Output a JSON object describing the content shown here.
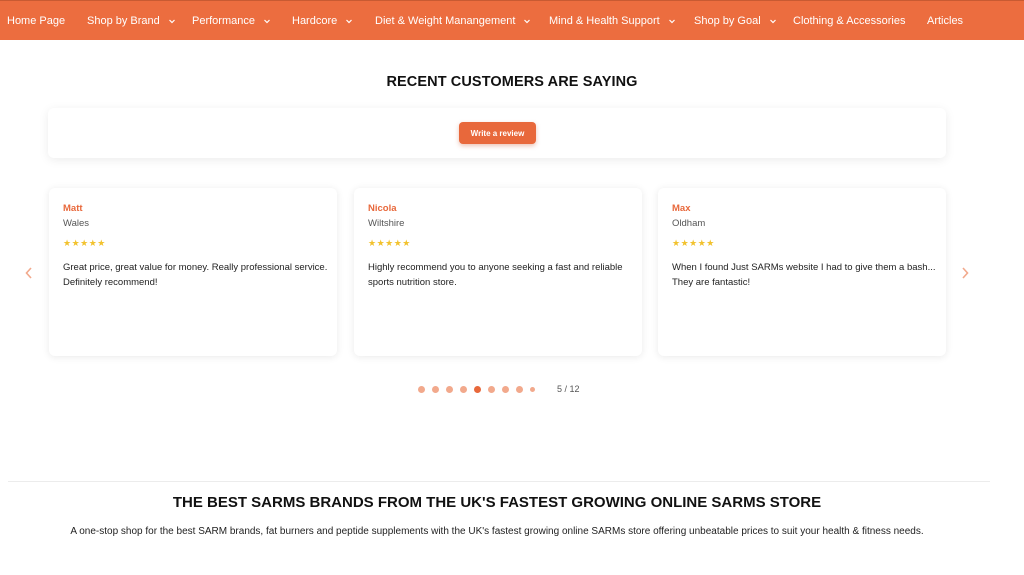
{
  "nav": {
    "items": [
      {
        "label": "Home Page",
        "has_dropdown": false
      },
      {
        "label": "Shop by Brand",
        "has_dropdown": true
      },
      {
        "label": "Performance",
        "has_dropdown": true
      },
      {
        "label": "Hardcore",
        "has_dropdown": true
      },
      {
        "label": "Diet & Weight Manangement",
        "has_dropdown": true
      },
      {
        "label": "Mind & Health Support",
        "has_dropdown": true
      },
      {
        "label": "Shop by Goal",
        "has_dropdown": true
      },
      {
        "label": "Clothing & Accessories",
        "has_dropdown": false
      },
      {
        "label": "Articles",
        "has_dropdown": false
      }
    ],
    "bg_color": "#ec6d3f"
  },
  "reviews": {
    "title": "RECENT CUSTOMERS ARE SAYING",
    "write_review_label": "Write a review",
    "cards": [
      {
        "name": "Matt",
        "location": "Wales",
        "stars": "★★★★★",
        "rating": 5,
        "text": "Great price, great value for money. Really professional service. Definitely recommend!"
      },
      {
        "name": "Nicola",
        "location": "Wiltshire",
        "stars": "★★★★★",
        "rating": 5,
        "text": "Highly recommend you to anyone seeking a fast and reliable sports nutrition store."
      },
      {
        "name": "Max",
        "location": "Oldham",
        "stars": "★★★★★",
        "rating": 5,
        "text": "When I found Just SARMs website I had to give them a bash... They are fantastic!"
      }
    ],
    "prev_icon": "chevron-left-icon",
    "next_icon": "chevron-right-icon",
    "dots_total_visible": 9,
    "active_dot": 5,
    "counter": "5 / 12"
  },
  "brands": {
    "title": "THE BEST SARMS BRANDS FROM THE UK'S FASTEST GROWING ONLINE SARMS STORE",
    "description": "A one-stop shop for the best SARM brands, fat burners and peptide supplements with the UK's fastest growing online SARMs store offering unbeatable prices to suit your health & fitness needs."
  },
  "colors": {
    "accent": "#e8683b",
    "star": "#f2c22e"
  }
}
